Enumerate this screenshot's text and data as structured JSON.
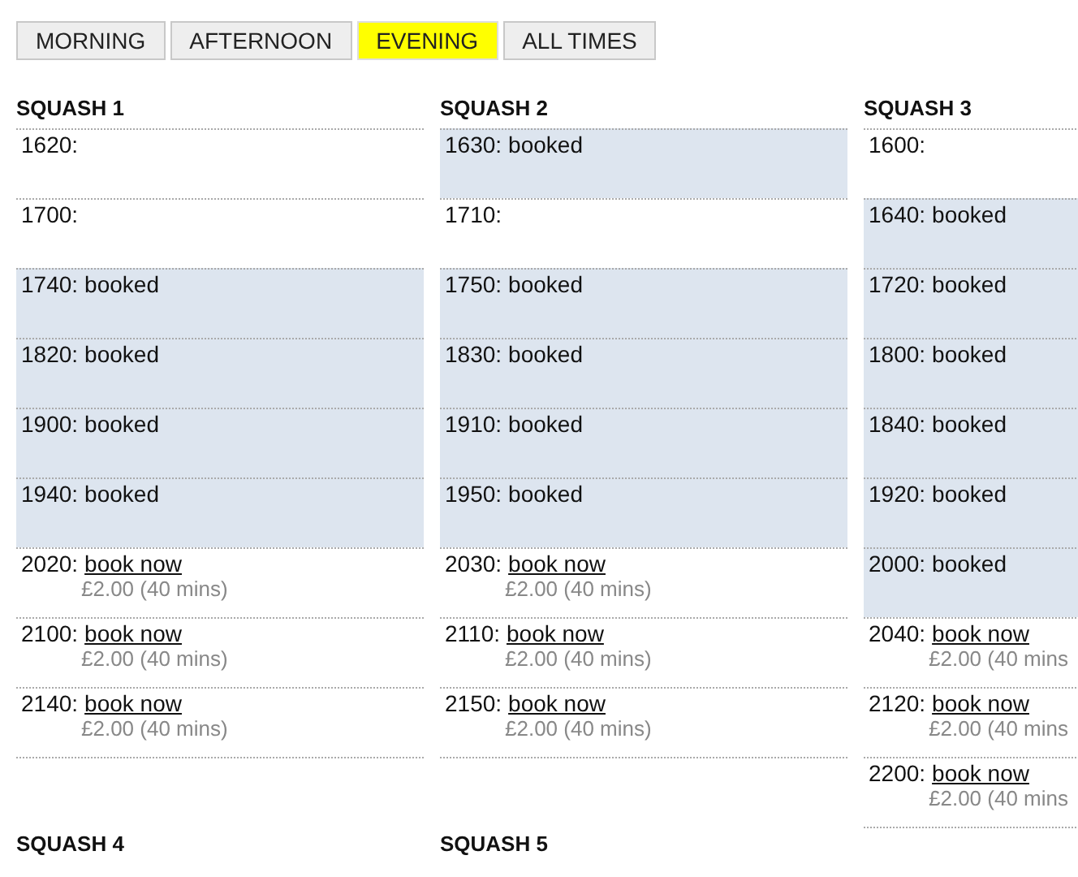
{
  "tabs": [
    {
      "label": "MORNING",
      "selected": false
    },
    {
      "label": "AFTERNOON",
      "selected": false
    },
    {
      "label": "EVENING",
      "selected": true
    },
    {
      "label": "ALL TIMES",
      "selected": false
    }
  ],
  "courts": [
    {
      "name": "SQUASH 1",
      "slots": [
        {
          "kind": "empty",
          "time": "1620:"
        },
        {
          "kind": "empty",
          "time": "1700:"
        },
        {
          "kind": "booked",
          "time": "1740:",
          "status": "booked"
        },
        {
          "kind": "booked",
          "time": "1820:",
          "status": "booked"
        },
        {
          "kind": "booked",
          "time": "1900:",
          "status": "booked"
        },
        {
          "kind": "booked",
          "time": "1940:",
          "status": "booked"
        },
        {
          "kind": "available",
          "time": "2020:",
          "link": "book now",
          "price": "£2.00 (40 mins)"
        },
        {
          "kind": "available",
          "time": "2100:",
          "link": "book now",
          "price": "£2.00 (40 mins)"
        },
        {
          "kind": "available",
          "time": "2140:",
          "link": "book now",
          "price": "£2.00 (40 mins)"
        }
      ]
    },
    {
      "name": "SQUASH 2",
      "slots": [
        {
          "kind": "booked",
          "time": "1630:",
          "status": "booked"
        },
        {
          "kind": "empty",
          "time": "1710:"
        },
        {
          "kind": "booked",
          "time": "1750:",
          "status": "booked"
        },
        {
          "kind": "booked",
          "time": "1830:",
          "status": "booked"
        },
        {
          "kind": "booked",
          "time": "1910:",
          "status": "booked"
        },
        {
          "kind": "booked",
          "time": "1950:",
          "status": "booked"
        },
        {
          "kind": "available",
          "time": "2030:",
          "link": "book now",
          "price": "£2.00 (40 mins)"
        },
        {
          "kind": "available",
          "time": "2110:",
          "link": "book now",
          "price": "£2.00 (40 mins)"
        },
        {
          "kind": "available",
          "time": "2150:",
          "link": "book now",
          "price": "£2.00 (40 mins)"
        }
      ]
    },
    {
      "name": "SQUASH 3",
      "slots": [
        {
          "kind": "empty",
          "time": "1600:"
        },
        {
          "kind": "booked",
          "time": "1640:",
          "status": "booked"
        },
        {
          "kind": "booked",
          "time": "1720:",
          "status": "booked"
        },
        {
          "kind": "booked",
          "time": "1800:",
          "status": "booked"
        },
        {
          "kind": "booked",
          "time": "1840:",
          "status": "booked"
        },
        {
          "kind": "booked",
          "time": "1920:",
          "status": "booked"
        },
        {
          "kind": "booked",
          "time": "2000:",
          "status": "booked"
        },
        {
          "kind": "available",
          "time": "2040:",
          "link": "book now",
          "price": "£2.00 (40 mins"
        },
        {
          "kind": "available",
          "time": "2120:",
          "link": "book now",
          "price": "£2.00 (40 mins"
        },
        {
          "kind": "available",
          "time": "2200:",
          "link": "book now",
          "price": "£2.00 (40 mins"
        }
      ]
    }
  ],
  "more_courts": [
    {
      "name": "SQUASH 4"
    },
    {
      "name": "SQUASH 5"
    }
  ]
}
